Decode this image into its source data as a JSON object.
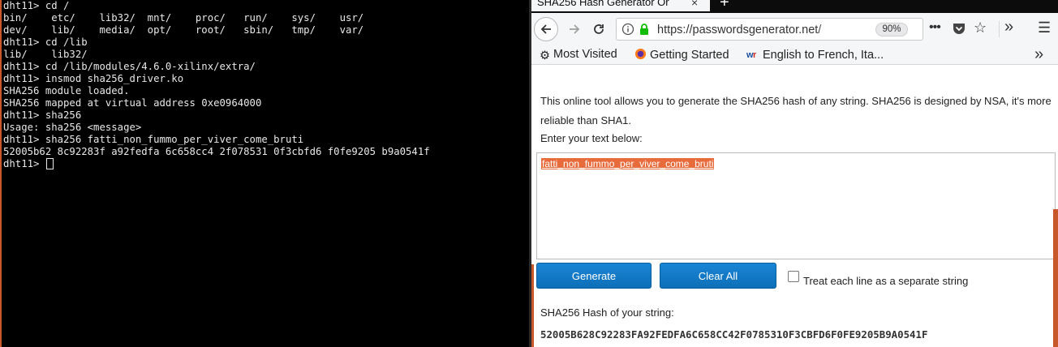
{
  "terminal": {
    "lines": [
      "dht11> cd /",
      "bin/    etc/    lib32/  mnt/    proc/   run/    sys/    usr/",
      "dev/    lib/    media/  opt/    root/   sbin/   tmp/    var/",
      "dht11> cd /lib",
      "lib/    lib32/",
      "dht11> cd /lib/modules/4.6.0-xilinx/extra/",
      "dht11> insmod sha256_driver.ko",
      "SHA256 module loaded.",
      "SHA256 mapped at virtual address 0xe0964000",
      "dht11> sha256",
      "Usage: sha256 <message>",
      "dht11> sha256 fatti_non_fummo_per_viver_come_bruti",
      "52005b62 8c92283f a92fedfa 6c658cc4 2f078531 0f3cbfd6 f0fe9205 b9a0541f"
    ],
    "prompt": "dht11> "
  },
  "browser": {
    "tab_title": "SHA256 Hash Generator Or",
    "tab_close": "×",
    "new_tab": "+",
    "url": "https://passwordsgenerator.net/",
    "zoom": "90%",
    "bookmarks": {
      "most_visited": "Most Visited",
      "getting_started": "Getting Started",
      "translate": "English to French, Ita..."
    },
    "page": {
      "intro_line1": "This online tool allows you to generate the SHA256 hash of any string. SHA256 is designed by NSA, it's more",
      "intro_line2": "reliable than SHA1.",
      "enter_label": "Enter your text below:",
      "input_value": "fatti_non_fummo_per_viver_come_bruti",
      "generate_label": "Generate",
      "clear_label": "Clear All",
      "checkbox_label": "Treat each line as a separate string",
      "hash_label": "SHA256 Hash of your string:",
      "hash_value": "52005B628C92283FA92FEDFA6C658CC42F0785310F3CBFD6F0FE9205B9A0541F"
    }
  },
  "colors": {
    "accent": "#c8582a",
    "button_blue": "#1a85d6",
    "selection": "#e86b3c"
  }
}
